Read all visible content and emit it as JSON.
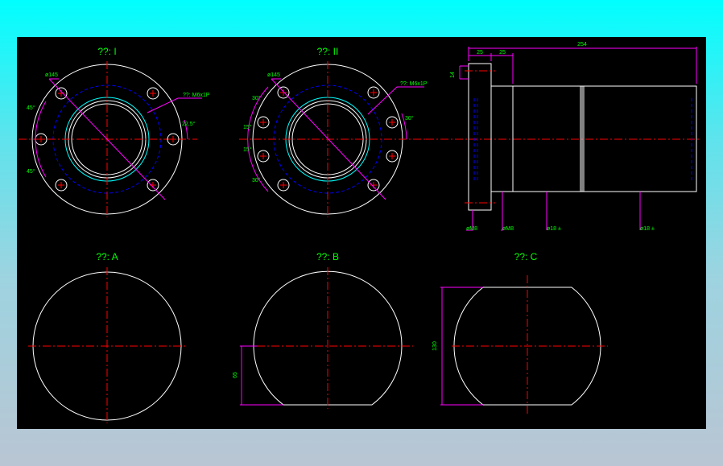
{
  "colors": {
    "background": "#000000",
    "outline": "#ffffff",
    "centerline": "#ff0000",
    "hidden": "#0000ff",
    "thread": "#00ffff",
    "dimension": "#ff00ff",
    "text": "#00ff00"
  },
  "views": {
    "v1": {
      "title": "??: I",
      "dim_diameter": "ø145",
      "dim_thread": "??: M6x1P",
      "dim_angle_top": "45°",
      "dim_angle_bottom": "45°",
      "dim_angle_right": "22.5°"
    },
    "v2": {
      "title": "??: II",
      "dim_diameter": "ø145",
      "dim_thread": "??: M6x1P",
      "dim_a1": "30°",
      "dim_a2": "15°",
      "dim_a3": "15°",
      "dim_a4": "30°",
      "dim_a5": "30°"
    },
    "side": {
      "dim_total": "254",
      "dim_25a": "25",
      "dim_25b": "25",
      "dim_14": "14",
      "dim_d1": "øM8",
      "dim_d2": "øM8",
      "dim_d3": "ø18 ±",
      "dim_d4": "ø18 ±"
    },
    "a": {
      "title": "??: A"
    },
    "b": {
      "title": "??: B",
      "dim_height": "65"
    },
    "c": {
      "title": "??: C",
      "dim_width": "130"
    }
  }
}
